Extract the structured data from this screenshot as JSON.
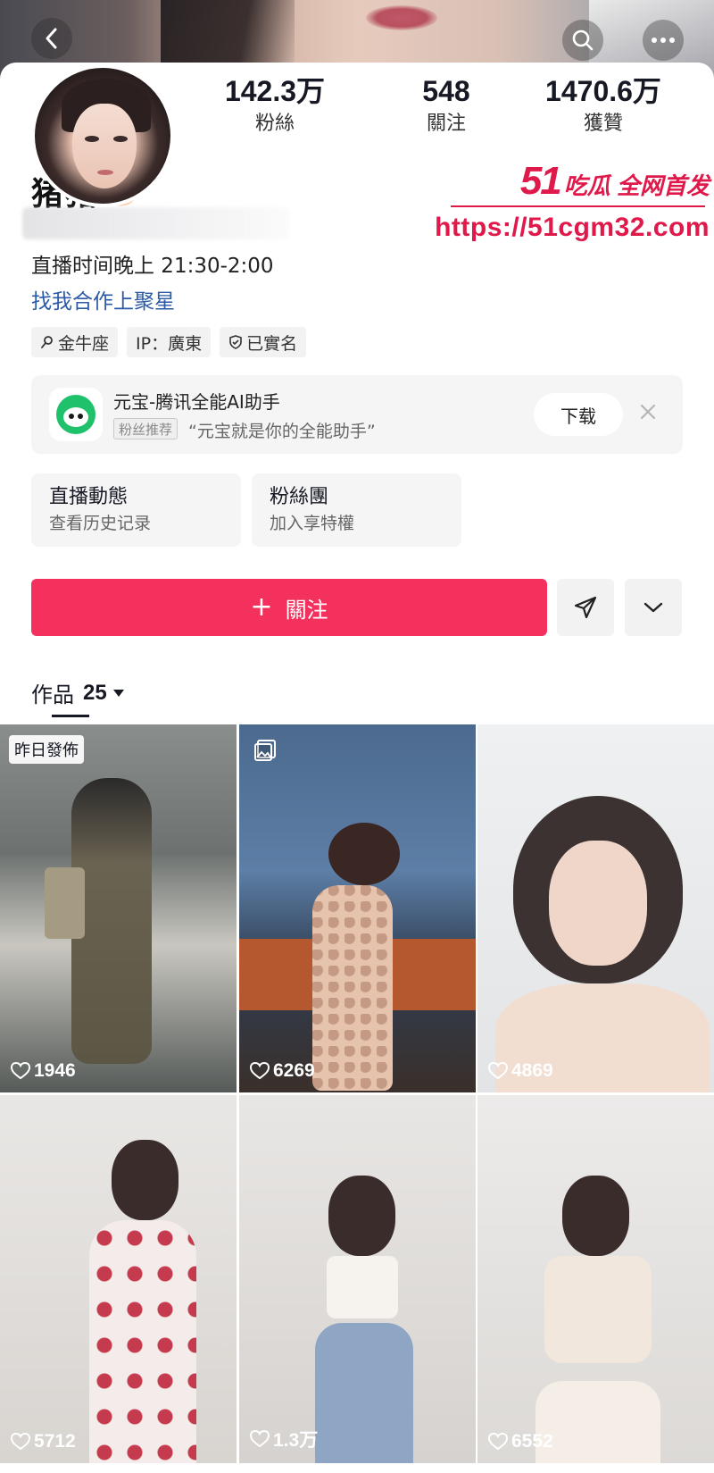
{
  "header": {
    "back_icon": "chevron-left-icon",
    "search_icon": "search-icon",
    "more_icon": "more-dots-icon"
  },
  "profile": {
    "name": "猪猪",
    "name_emoji": "🐷",
    "stats": [
      {
        "value": "142.3万",
        "label": "粉絲"
      },
      {
        "value": "548",
        "label": "關注"
      },
      {
        "value": "1470.6万",
        "label": "獲贊"
      }
    ],
    "bio_line1": "直播时间晚上 21:30-2:00",
    "bio_line2": "找我合作上聚星",
    "tags": [
      {
        "icon": "location-pin-icon",
        "text": "金牛座"
      },
      {
        "icon": "",
        "text": "IP：廣東"
      },
      {
        "icon": "shield-check-icon",
        "text": "已實名"
      }
    ]
  },
  "watermark": {
    "brand_num": "51",
    "brand_text": "吃瓜 全网首发",
    "url": "https://51cgm32.com"
  },
  "promo": {
    "app_name": "元宝-腾讯全能AI助手",
    "badge": "粉丝推荐",
    "slogan": "“元宝就是你的全能助手”",
    "download_label": "下载"
  },
  "cards": [
    {
      "title": "直播動態",
      "subtitle": "查看历史记录"
    },
    {
      "title": "粉絲團",
      "subtitle": "加入享特權"
    }
  ],
  "actions": {
    "follow_label": "關注",
    "follow_plus": "+"
  },
  "works": {
    "tab_label": "作品",
    "count": "25"
  },
  "posts": [
    {
      "likes": "1946",
      "label": "昨日發佈"
    },
    {
      "likes": "6269",
      "badge_icon": "image-gallery-icon"
    },
    {
      "likes": "4869"
    },
    {
      "likes": "5712"
    },
    {
      "likes": "1.3万"
    },
    {
      "likes": "6552"
    }
  ],
  "colors": {
    "accent": "#f4305c",
    "link": "#2b5aa6",
    "watermark": "#e0194b"
  }
}
